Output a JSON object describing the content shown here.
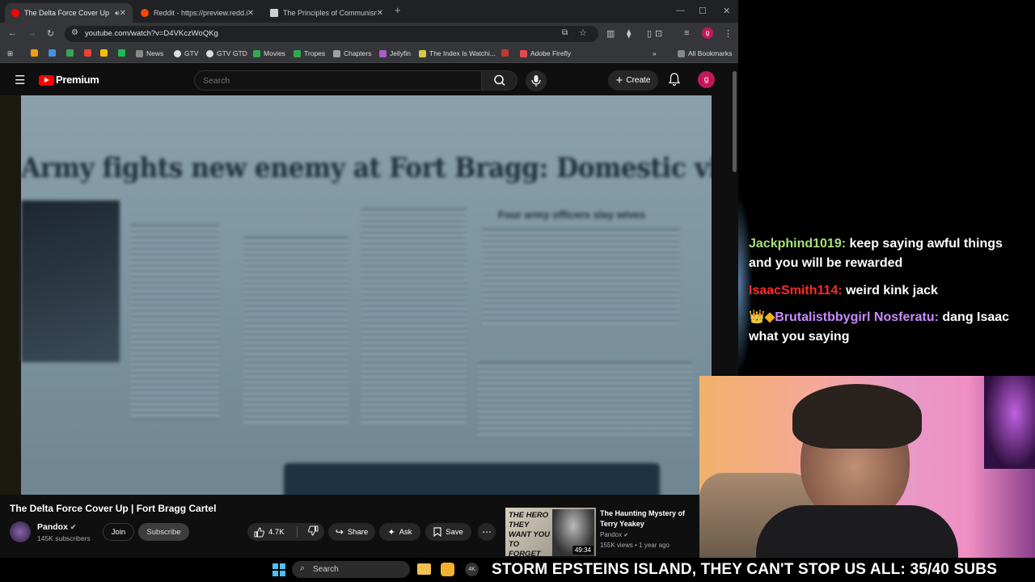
{
  "browser": {
    "tabs": [
      {
        "label": "The Delta Force Cover Up | F",
        "active": true
      },
      {
        "label": "Reddit - https://preview.redd.it/",
        "active": false
      },
      {
        "label": "The Principles of Communism",
        "active": false
      }
    ],
    "new_tab": "+",
    "url": "youtube.com/watch?v=D4VKczWoQKg",
    "bookmarks": [
      "News",
      "GTV",
      "GTV GTD",
      "Movies",
      "Tropes",
      "Chapters",
      "Jellyfin",
      "The Index Is Watchi...",
      "Adobe Firefly"
    ],
    "all_bookmarks": "All Bookmarks"
  },
  "youtube": {
    "brand": "Premium",
    "search_placeholder": "Search",
    "create_label": "Create",
    "avatar_letter": "g",
    "video": {
      "headline": "Army fights new enemy at Fort Bragg: Domestic violence",
      "subhead": "Four army officers slay wives",
      "title": "The Delta Force Cover Up | Fort Bragg Cartel",
      "channel": "Pandox",
      "subscribers": "145K subscribers",
      "join_label": "Join",
      "subscribe_label": "Subscribe",
      "likes": "4.7K",
      "share_label": "Share",
      "ask_label": "Ask",
      "save_label": "Save"
    },
    "suggestion": {
      "title": "The Haunting Mystery of Terry Yeakey",
      "thumb_text": "THE HERO THEY WANT YOU TO FORGET",
      "duration": "49:34",
      "channel": "Pandox",
      "meta": "155K views • 1 year ago"
    }
  },
  "chat": [
    {
      "user": "Jackphind1019:",
      "text": " keep saying awful things and you will be rewarded",
      "color": "#a6e07a"
    },
    {
      "user": "IsaacSmith114:",
      "text": " weird kink jack",
      "color": "#ff2a2a"
    },
    {
      "user": "Brutalistbbygirl Nosferatu:",
      "text": " dang Isaac what you saying",
      "color": "#c78bff",
      "badges": "👑◆"
    }
  ],
  "taskbar": {
    "search_label": "Search",
    "ticker": "STORM EPSTEINS ISLAND, THEY CAN'T STOP US ALL: 35/40 SUBS"
  }
}
